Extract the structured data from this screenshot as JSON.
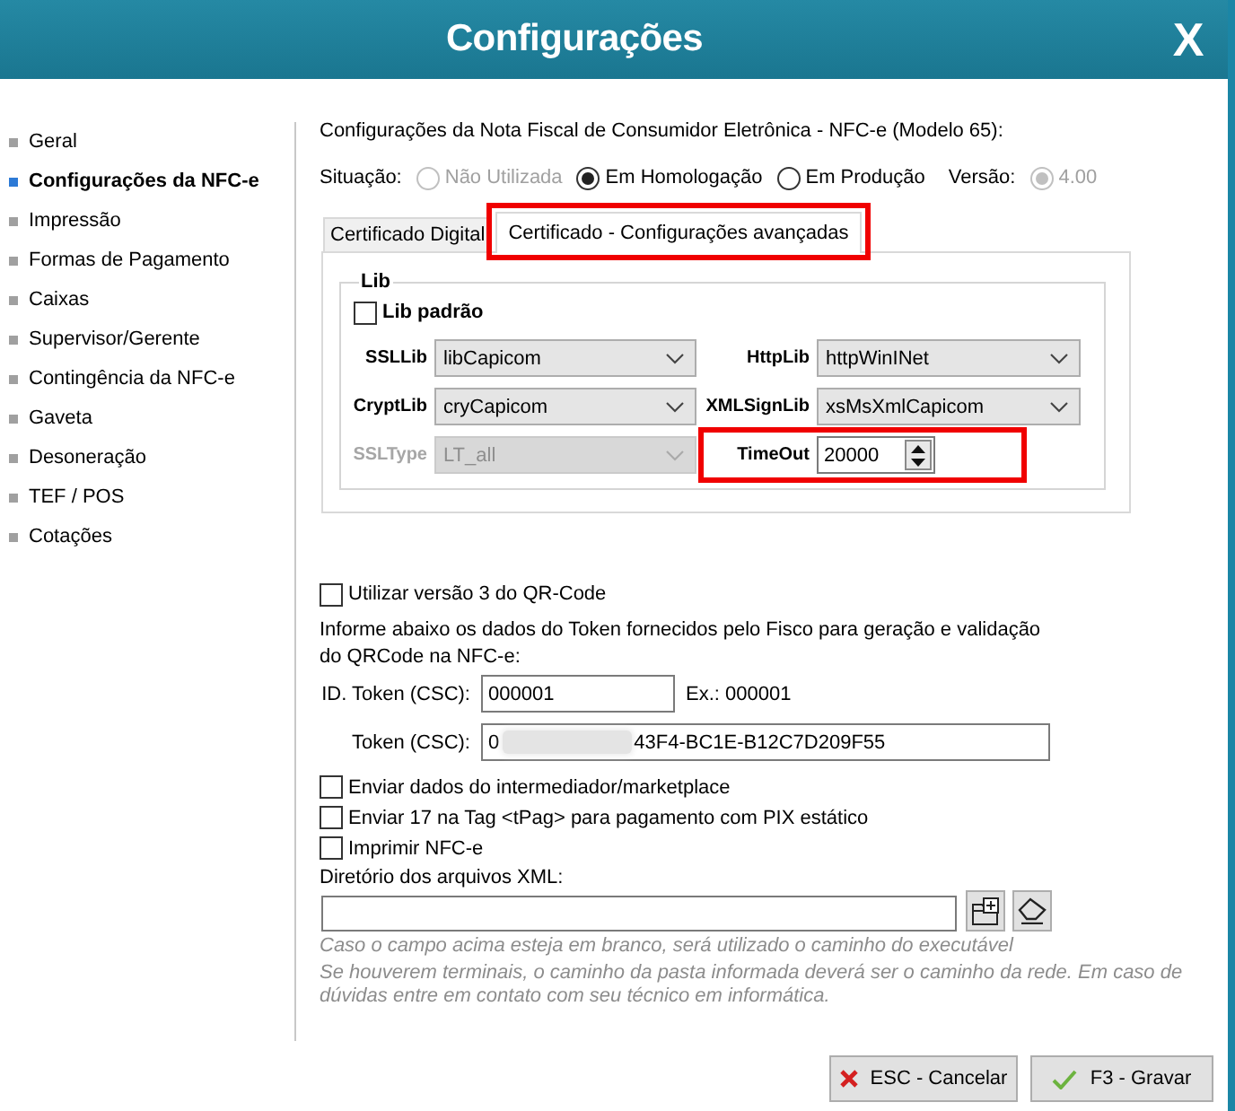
{
  "window": {
    "title": "Configurações",
    "close_label": "X"
  },
  "sidebar": {
    "items": [
      {
        "label": "Geral",
        "selected": false
      },
      {
        "label": "Configurações da NFC-e",
        "selected": true
      },
      {
        "label": "Impressão",
        "selected": false
      },
      {
        "label": "Formas de Pagamento",
        "selected": false
      },
      {
        "label": "Caixas",
        "selected": false
      },
      {
        "label": "Supervisor/Gerente",
        "selected": false
      },
      {
        "label": "Contingência da NFC-e",
        "selected": false
      },
      {
        "label": "Gaveta",
        "selected": false
      },
      {
        "label": "Desoneração",
        "selected": false
      },
      {
        "label": "TEF / POS",
        "selected": false
      },
      {
        "label": "Cotações",
        "selected": false
      }
    ]
  },
  "heading": "Configurações da Nota Fiscal de Consumidor Eletrônica - NFC-e (Modelo 65):",
  "situacao": {
    "label": "Situação:",
    "options": [
      {
        "label": "Não Utilizada",
        "selected": false,
        "disabled": true
      },
      {
        "label": "Em Homologação",
        "selected": true,
        "disabled": false
      },
      {
        "label": "Em Produção",
        "selected": false,
        "disabled": false
      }
    ]
  },
  "versao": {
    "label": "Versão:",
    "options": [
      {
        "label": "4.00",
        "selected": true,
        "disabled": true
      }
    ]
  },
  "tabs": [
    {
      "label": "Certificado Digital",
      "selected": false,
      "highlighted": false
    },
    {
      "label": "Certificado - Configurações avançadas",
      "selected": true,
      "highlighted": true
    }
  ],
  "lib": {
    "title": "Lib",
    "default_checkbox": {
      "label": "Lib padrão",
      "checked": false
    },
    "fields": [
      {
        "label": "SSLLib",
        "kind": "combo",
        "value": "libCapicom",
        "disabled": false,
        "highlighted": false
      },
      {
        "label": "HttpLib",
        "kind": "combo",
        "value": "httpWinINet",
        "disabled": false,
        "highlighted": false
      },
      {
        "label": "CryptLib",
        "kind": "combo",
        "value": "cryCapicom",
        "disabled": false,
        "highlighted": false
      },
      {
        "label": "XMLSignLib",
        "kind": "combo",
        "value": "xsMsXmlCapicom",
        "disabled": false,
        "highlighted": false
      },
      {
        "label": "SSLType",
        "kind": "combo",
        "value": "LT_all",
        "disabled": true,
        "highlighted": false
      },
      {
        "label": "TimeOut",
        "kind": "spin",
        "value": "20000",
        "disabled": false,
        "highlighted": true
      }
    ]
  },
  "qr_version": {
    "label": "Utilizar versão 3 do QR-Code",
    "checked": false
  },
  "token_info": "Informe abaixo os dados do Token fornecidos pelo Fisco para geração e validação do QRCode na NFC-e:",
  "id_token": {
    "label": "ID. Token (CSC):",
    "value": "000001",
    "example": "Ex.: 000001"
  },
  "token": {
    "label": "Token (CSC):",
    "value_parts": [
      "0",
      "43F4-BC1E-B12C7D209F55"
    ],
    "redacted": true
  },
  "options": [
    {
      "label": "Enviar dados do intermediador/marketplace",
      "checked": false
    },
    {
      "label": "Enviar 17 na Tag <tPag> para pagamento com PIX estático",
      "checked": false
    },
    {
      "label": "Imprimir NFC-e",
      "checked": false
    }
  ],
  "xml_directory": {
    "label": "Diretório dos arquivos XML:",
    "hints": [
      "Caso o campo acima esteja em branco, será utilizado o caminho do executável",
      "Se houverem terminais, o caminho da pasta informada deverá ser o caminho da rede. Em caso de dúvidas entre em contato com seu técnico em informática."
    ]
  },
  "buttons": [
    {
      "label": "ESC - Cancelar",
      "kind": "cancel"
    },
    {
      "label": "F3 - Gravar",
      "kind": "save"
    }
  ]
}
